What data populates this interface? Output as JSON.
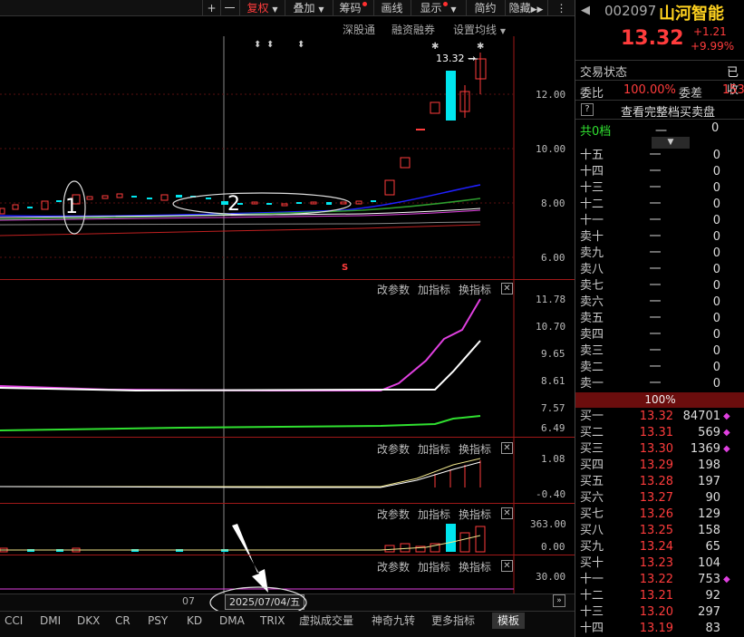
{
  "toolbar": {
    "plus": "+",
    "minus": "一",
    "fuquan": "复权",
    "diejia": "叠加",
    "chouma": "筹码",
    "huaxian": "画线",
    "xianshi": "显示",
    "jianyue": "简约",
    "yincang": "隐藏"
  },
  "subbar": {
    "shengutong": "深股通",
    "rongzi": "融资融券",
    "junxian": "设置均线"
  },
  "main_chart": {
    "price_label": "13.32",
    "yticks": [
      "12.00",
      "10.00",
      "8.00",
      "6.00"
    ],
    "annotation_1": "1",
    "annotation_2": "2",
    "s_marker": "S"
  },
  "panels": {
    "gaicanshu": "改参数",
    "jiazhibiao": "加指标",
    "huanzhibiao": "换指标",
    "p1_ticks": [
      "11.78",
      "10.70",
      "9.65",
      "8.61",
      "7.57",
      "6.49"
    ],
    "p2_ticks": [
      "1.08",
      "-0.40"
    ],
    "p3_ticks": [
      "363.00",
      "0.00"
    ],
    "p4_ticks": [
      "30.00"
    ]
  },
  "date_bar": {
    "month": "07",
    "date": "2025/07/04/五"
  },
  "bottom_tabs": [
    "CCI",
    "DMI",
    "DKX",
    "CR",
    "PSY",
    "KD",
    "DMA",
    "TRIX",
    "虚拟成交量",
    "神奇九转",
    "更多指标",
    "模板"
  ],
  "stock": {
    "code": "002097",
    "name": "山河智能",
    "price": "13.32",
    "change": "+1.21",
    "pct": "+9.99%",
    "status_label": "交易状态",
    "status_value": "已收",
    "weibi_label": "委比",
    "weibi_value": "100.00%",
    "weicha_label": "委差",
    "weicha_value": "153",
    "view_full": "查看完整档买卖盘",
    "help": "?",
    "total_label": "共0档",
    "total_dash": "一",
    "total_value": "0",
    "ratio": "100%"
  },
  "sell_levels": [
    {
      "label": "十五",
      "price": "一",
      "vol": "0"
    },
    {
      "label": "十四",
      "price": "一",
      "vol": "0"
    },
    {
      "label": "十三",
      "price": "一",
      "vol": "0"
    },
    {
      "label": "十二",
      "price": "一",
      "vol": "0"
    },
    {
      "label": "十一",
      "price": "一",
      "vol": "0"
    },
    {
      "label": "卖十",
      "price": "一",
      "vol": "0"
    },
    {
      "label": "卖九",
      "price": "一",
      "vol": "0"
    },
    {
      "label": "卖八",
      "price": "一",
      "vol": "0"
    },
    {
      "label": "卖七",
      "price": "一",
      "vol": "0"
    },
    {
      "label": "卖六",
      "price": "一",
      "vol": "0"
    },
    {
      "label": "卖五",
      "price": "一",
      "vol": "0"
    },
    {
      "label": "卖四",
      "price": "一",
      "vol": "0"
    },
    {
      "label": "卖三",
      "price": "一",
      "vol": "0"
    },
    {
      "label": "卖二",
      "price": "一",
      "vol": "0"
    },
    {
      "label": "卖一",
      "price": "一",
      "vol": "0"
    }
  ],
  "buy_levels": [
    {
      "label": "买一",
      "price": "13.32",
      "vol": "84701",
      "mark": true
    },
    {
      "label": "买二",
      "price": "13.31",
      "vol": "569",
      "mark": true
    },
    {
      "label": "买三",
      "price": "13.30",
      "vol": "1369",
      "mark": true
    },
    {
      "label": "买四",
      "price": "13.29",
      "vol": "198",
      "mark": false
    },
    {
      "label": "买五",
      "price": "13.28",
      "vol": "197",
      "mark": false
    },
    {
      "label": "买六",
      "price": "13.27",
      "vol": "90",
      "mark": false
    },
    {
      "label": "买七",
      "price": "13.26",
      "vol": "129",
      "mark": false
    },
    {
      "label": "买八",
      "price": "13.25",
      "vol": "158",
      "mark": false
    },
    {
      "label": "买九",
      "price": "13.24",
      "vol": "65",
      "mark": false
    },
    {
      "label": "买十",
      "price": "13.23",
      "vol": "104",
      "mark": false
    },
    {
      "label": "十一",
      "price": "13.22",
      "vol": "753",
      "mark": true
    },
    {
      "label": "十二",
      "price": "13.21",
      "vol": "92",
      "mark": false
    },
    {
      "label": "十三",
      "price": "13.20",
      "vol": "297",
      "mark": false
    },
    {
      "label": "十四",
      "price": "13.19",
      "vol": "83",
      "mark": false
    }
  ],
  "colors": {
    "up": "#ff3c3c",
    "down": "#00e5ee",
    "grid": "#a01818",
    "accent": "#e040e0"
  }
}
